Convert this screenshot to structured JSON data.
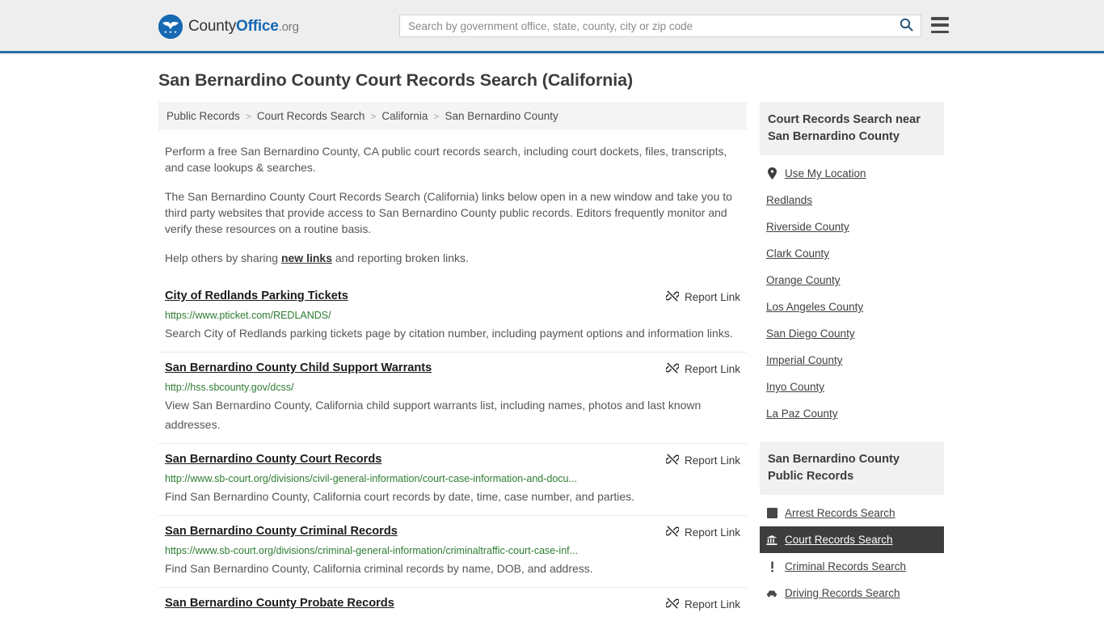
{
  "header": {
    "brand": {
      "part1": "County",
      "part2": "Office",
      "tld": ".org",
      "logo_icon": "eagle-seal-icon"
    },
    "search": {
      "placeholder": "Search by government office, state, county, city or zip code",
      "value": "",
      "icon": "search-icon"
    },
    "menu_icon": "hamburger-menu-icon",
    "accent_color": "#2e6da4",
    "background_color": "#eeeeee"
  },
  "page": {
    "title": "San Bernardino County Court Records Search (California)"
  },
  "breadcrumb": {
    "separator": ">",
    "items": [
      {
        "label": "Public Records"
      },
      {
        "label": "Court Records Search"
      },
      {
        "label": "California"
      },
      {
        "label": "San Bernardino County"
      }
    ]
  },
  "intro": {
    "p1": "Perform a free San Bernardino County, CA public court records search, including court dockets, files, transcripts, and case lookups & searches.",
    "p2": "The San Bernardino County Court Records Search (California) links below open in a new window and take you to third party websites that provide access to San Bernardino County public records. Editors frequently monitor and verify these resources on a routine basis.",
    "p3_before": "Help others by sharing ",
    "p3_link": "new links",
    "p3_after": " and reporting broken links."
  },
  "results": {
    "report_label": "Report Link",
    "report_icon": "broken-link-icon",
    "items": [
      {
        "title": "City of Redlands Parking Tickets",
        "url": "https://www.pticket.com/REDLANDS/",
        "description": "Search City of Redlands parking tickets page by citation number, including payment options and information links."
      },
      {
        "title": "San Bernardino County Child Support Warrants",
        "url": "http://hss.sbcounty.gov/dcss/",
        "description": "View San Bernardino County, California child support warrants list, including names, photos and last known addresses."
      },
      {
        "title": "San Bernardino County Court Records",
        "url": "http://www.sb-court.org/divisions/civil-general-information/court-case-information-and-docu...",
        "description": "Find San Bernardino County, California court records by date, time, case number, and parties."
      },
      {
        "title": "San Bernardino County Criminal Records",
        "url": "https://www.sb-court.org/divisions/criminal-general-information/criminaltraffic-court-case-inf...",
        "description": "Find San Bernardino County, California criminal records by name, DOB, and address."
      },
      {
        "title": "San Bernardino County Probate Records",
        "url": "",
        "description": ""
      }
    ]
  },
  "sidebar": {
    "nearby": {
      "heading": "Court Records Search near San Bernardino County",
      "items": [
        {
          "label": "Use My Location",
          "icon": "map-pin-icon"
        },
        {
          "label": "Redlands",
          "icon": ""
        },
        {
          "label": "Riverside County",
          "icon": ""
        },
        {
          "label": "Clark County",
          "icon": ""
        },
        {
          "label": "Orange County",
          "icon": ""
        },
        {
          "label": "Los Angeles County",
          "icon": ""
        },
        {
          "label": "San Diego County",
          "icon": ""
        },
        {
          "label": "Imperial County",
          "icon": ""
        },
        {
          "label": "Inyo County",
          "icon": ""
        },
        {
          "label": "La Paz County",
          "icon": ""
        }
      ]
    },
    "public_records": {
      "heading": "San Bernardino County Public Records",
      "active_index": 1,
      "items": [
        {
          "label": "Arrest Records Search",
          "icon": "fingerprint-square-icon"
        },
        {
          "label": "Court Records Search",
          "icon": "courthouse-icon"
        },
        {
          "label": "Criminal Records Search",
          "icon": "exclamation-icon"
        },
        {
          "label": "Driving Records Search",
          "icon": "car-icon"
        }
      ]
    }
  }
}
